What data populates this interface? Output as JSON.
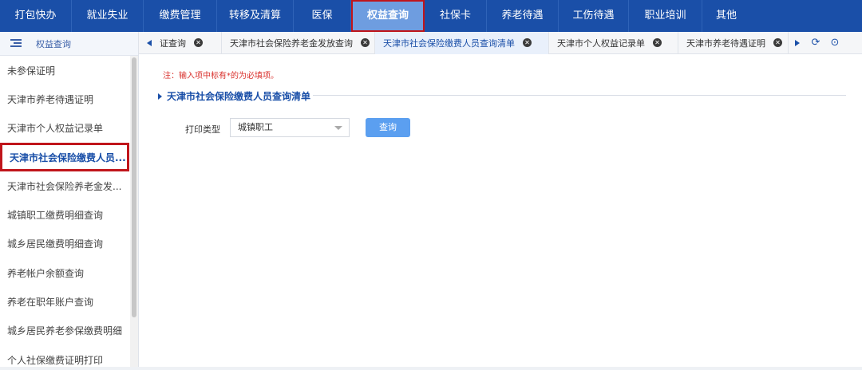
{
  "topnav": {
    "items": [
      {
        "label": "打包快办",
        "active": false
      },
      {
        "label": "就业失业",
        "active": false
      },
      {
        "label": "缴费管理",
        "active": false
      },
      {
        "label": "转移及清算",
        "active": false
      },
      {
        "label": "医保",
        "active": false
      },
      {
        "label": "权益查询",
        "active": true
      },
      {
        "label": "社保卡",
        "active": false
      },
      {
        "label": "养老待遇",
        "active": false
      },
      {
        "label": "工伤待遇",
        "active": false
      },
      {
        "label": "职业培训",
        "active": false
      },
      {
        "label": "其他",
        "active": false
      }
    ]
  },
  "sidebar": {
    "title": "权益查询",
    "items": [
      {
        "label": "未参保证明"
      },
      {
        "label": "天津市养老待遇证明"
      },
      {
        "label": "天津市个人权益记录单"
      },
      {
        "label": "天津市社会保险缴费人员..."
      },
      {
        "label": "天津市社会保险养老金发..."
      },
      {
        "label": "城镇职工缴费明细查询"
      },
      {
        "label": "城乡居民缴费明细查询"
      },
      {
        "label": "养老帐户余额查询"
      },
      {
        "label": "养老在职年账户查询"
      },
      {
        "label": "城乡居民养老参保缴费明细"
      },
      {
        "label": "个人社保缴费证明打印"
      }
    ],
    "selected_index": 3
  },
  "tabs": [
    {
      "label": "证查询",
      "active": false
    },
    {
      "label": "天津市社会保险养老金发放查询",
      "active": false
    },
    {
      "label": "天津市社会保险缴费人员查询清单",
      "active": true
    },
    {
      "label": "天津市个人权益记录单",
      "active": false
    },
    {
      "label": "天津市养老待遇证明",
      "active": false
    }
  ],
  "main": {
    "note": "注：输入项中标有*的为必填项。",
    "section_title": "天津市社会保险缴费人员查询清单",
    "form": {
      "print_type_label": "打印类型",
      "print_type_value": "城镇职工",
      "query_button": "查询"
    }
  },
  "colors": {
    "nav_bg": "#1a4fa8",
    "nav_active_bg": "#6e9de0",
    "highlight_border": "#c0151b",
    "accent": "#1a4fa8",
    "button": "#5b9ff0",
    "note_red": "#d9302c"
  },
  "icons": {
    "sidebar_menu": "menu-icon",
    "tab_prev": "triangle-left-icon",
    "tab_next": "triangle-right-icon",
    "refresh": "refresh-icon",
    "more": "more-icon",
    "tab_close": "close-circle-icon"
  }
}
